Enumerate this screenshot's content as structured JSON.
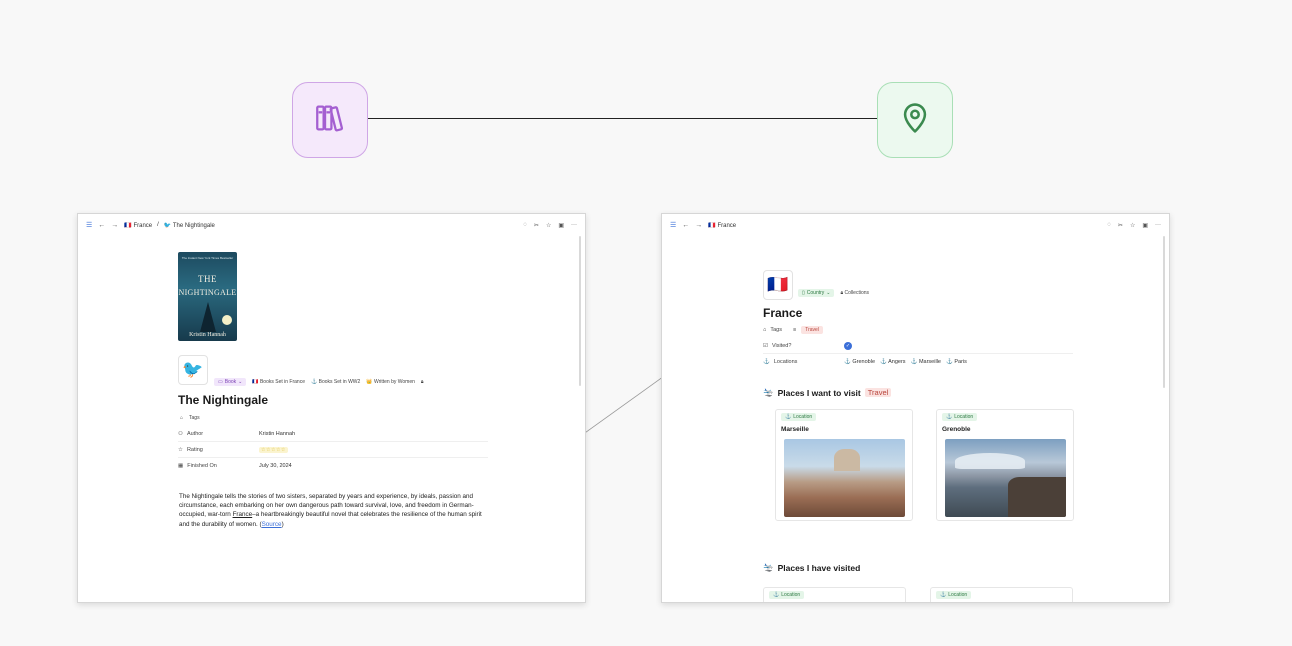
{
  "icons": {
    "books": "books-icon",
    "pin": "map-pin-icon"
  },
  "colors": {
    "books_accent": "#a45fd1",
    "pin_accent": "#3b8a4f",
    "link": "#3b6fd8"
  },
  "left_window": {
    "breadcrumb": [
      {
        "emoji": "🇫🇷",
        "label": "France"
      },
      {
        "emoji": "🐦",
        "label": "The Nightingale"
      }
    ],
    "breadcrumb_sep": "/",
    "cover": {
      "top_text": "The Instant New York Times Bestseller",
      "title_line1": "THE",
      "title_line2": "NIGHTINGALE",
      "author": "Kristin Hannah"
    },
    "page_emoji": "🐦",
    "tags": {
      "type": "Book",
      "collections": [
        {
          "emoji": "🇫🇷",
          "label": "Books Set in France"
        },
        {
          "emoji": "⚓",
          "label": "Books Set in WW2"
        },
        {
          "emoji": "👑",
          "label": "Written by Women"
        }
      ]
    },
    "title": "The Nightingale",
    "tags_label": "Tags",
    "properties": [
      {
        "key": "Author",
        "value": "Kristin Hannah"
      },
      {
        "key": "Rating",
        "value": "☆☆☆☆☆"
      },
      {
        "key": "Finished On",
        "value": "July 30, 2024"
      }
    ],
    "description": {
      "part1": "The Nightingale tells the stories of two sisters, separated by years and experience, by ideals, passion and circumstance, each embarking on her own dangerous path toward survival, love, and freedom in German-occupied, war-torn ",
      "link_text": "France",
      "part2": "–a heartbreakingly beautiful novel that celebrates the resilience of the human spirit and the durability of women. (",
      "source_text": "Source",
      "part3": ")"
    }
  },
  "right_window": {
    "breadcrumb": [
      {
        "emoji": "🇫🇷",
        "label": "France"
      }
    ],
    "page_emoji": "🇫🇷",
    "type_pill": "Country",
    "collections_label": "Collections",
    "title": "France",
    "tags_label": "Tags",
    "tag_value": "Travel",
    "visited_label": "Visited?",
    "locations_label": "Locations",
    "locations": [
      "Grenoble",
      "Angers",
      "Marseille",
      "Paris"
    ],
    "section1": {
      "emoji": "🛬",
      "title": "Places I want to visit",
      "tag": "Travel"
    },
    "cards": [
      {
        "pill": "Location",
        "name": "Marseille"
      },
      {
        "pill": "Location",
        "name": "Grenoble"
      }
    ],
    "section2": {
      "emoji": "🛬",
      "title": "Places I have visited"
    },
    "stub_cards": [
      {
        "pill": "Location"
      },
      {
        "pill": "Location"
      }
    ]
  }
}
